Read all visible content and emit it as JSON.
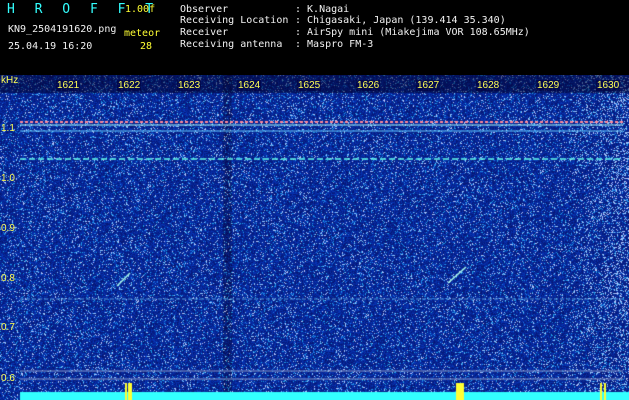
{
  "header": {
    "app_title": "H R O F F T",
    "version": "1.00f",
    "filename": "KN9_2504191620.png",
    "datetime": "25.04.19 16:20",
    "meteor_label": "meteor",
    "meteor_count": "28"
  },
  "info": [
    {
      "key": "Observer",
      "value": ": K.Nagai"
    },
    {
      "key": "Receiving Location",
      "value": ": Chigasaki, Japan (139.414 35.340)"
    },
    {
      "key": "Receiver",
      "value": ": AirSpy mini (Miakejima VOR 108.65MHz)"
    },
    {
      "key": "Receiving antenna",
      "value": ": Maspro FM-3"
    }
  ],
  "x_axis": {
    "ticks": [
      "1621",
      "1622",
      "1623",
      "1624",
      "1625",
      "1626",
      "1627",
      "1628",
      "1629",
      "1630"
    ]
  },
  "y_axis": {
    "unit": "kHz",
    "ticks": [
      "1.1",
      "1.0",
      "0.9",
      "0.8",
      "0.7",
      "0.6"
    ]
  },
  "colors": {
    "background": "#000000",
    "header_text": "#ffff33",
    "info_text": "#f2f2f2",
    "spectrogram_base": "#0a1a8a",
    "carrier": "#ff8888",
    "trace": "#66ffff",
    "baseline": "#33ffff"
  }
}
